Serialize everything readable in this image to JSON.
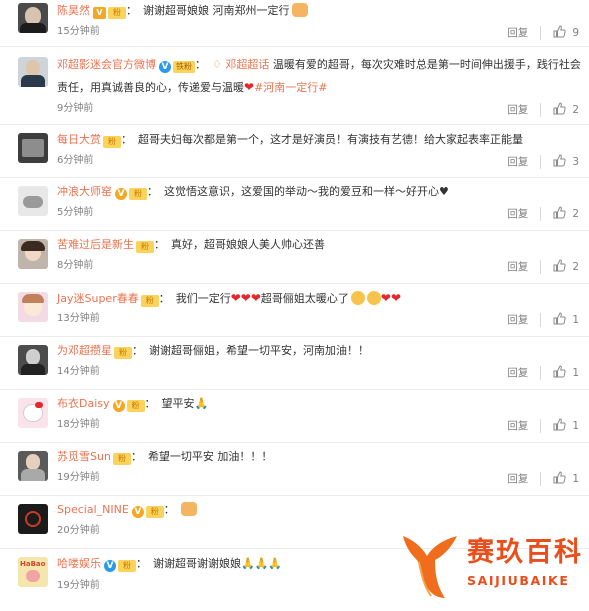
{
  "comments": [
    {
      "name": "陈昊然",
      "text": "谢谢超哥娘娘 河南郑州一定行",
      "time": "15分钟前",
      "reply_label": "回复",
      "likes": "9"
    },
    {
      "name": "邓超影迷会官方微博",
      "fan_label": "铁粉",
      "mention": "邓超超话",
      "text": "温暖有爱的超哥，每次灾难时总是第一时间伸出援手，践行社会责任，用真诚善良的心，传递爱与温暖",
      "hashtag": "#河南一定行#",
      "time": "9分钟前",
      "reply_label": "回复",
      "likes": "2"
    },
    {
      "name": "每日大赏",
      "text": "超哥夫妇每次都是第一个，这才是好演员！有演技有艺德！给大家起表率正能量",
      "time": "6分钟前",
      "reply_label": "回复",
      "likes": "3"
    },
    {
      "name": "冲浪大师窑",
      "text": "这觉悟这意识，这爱国的举动～我的爱豆和一样～好开心♥",
      "time": "5分钟前",
      "reply_label": "回复",
      "likes": "2"
    },
    {
      "name": "苦难过后是新生",
      "text": "真好，超哥娘娘人美人帅心还善",
      "time": "8分钟前",
      "reply_label": "回复",
      "likes": "2"
    },
    {
      "name": "Jay迷Super春春",
      "text_before": "我们一定行",
      "text_after": "超哥俪姐太暖心了",
      "time": "13分钟前",
      "reply_label": "回复",
      "likes": "1"
    },
    {
      "name": "为邓超攒星",
      "text": "谢谢超哥俪姐，希望一切平安，河南加油！！",
      "time": "14分钟前",
      "reply_label": "回复",
      "likes": "1"
    },
    {
      "name": "布衣Daisy",
      "text": "望平安🙏",
      "time": "18分钟前",
      "reply_label": "回复",
      "likes": "1"
    },
    {
      "name": "苏觅雪Sun",
      "text": "希望一切平安 加油！！！",
      "time": "19分钟前",
      "reply_label": "回复",
      "likes": "1"
    },
    {
      "name": "Special_NINE",
      "text": "",
      "time": "20分钟前",
      "reply_label": "回复",
      "likes": ""
    },
    {
      "name": "哈喽娱乐",
      "text": "谢谢超哥谢谢娘娘🙏🙏🙏",
      "time": "19分钟前",
      "reply_label": "回复",
      "likes": ""
    }
  ],
  "watermark": {
    "title": "赛玖百科",
    "subtitle": "SAIJIUBAIKE"
  },
  "colors": {
    "name": "#eb7350",
    "text": "#333333",
    "meta": "#808080",
    "accent": "#e94e1b"
  }
}
